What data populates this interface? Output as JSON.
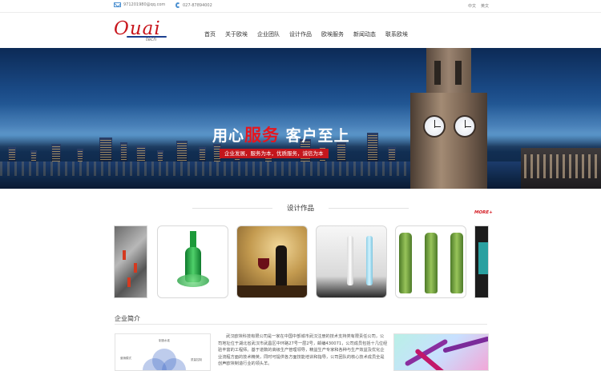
{
  "topbar": {
    "email": "971201980@qq.com",
    "phone": "027-87894002",
    "lang_zh": "中文",
    "lang_en": "英文"
  },
  "logo": {
    "text": "Ouai",
    "sub": "tech"
  },
  "nav": [
    "首页",
    "关于欧埃",
    "企业团队",
    "设计作品",
    "欧埃服务",
    "新闻动态",
    "联系欧埃"
  ],
  "banner": {
    "slogan_before": "用心",
    "slogan_highlight": "服务",
    "slogan_after": " 客户至上",
    "sub_slogan": "企业发展，服务为本，优质服务，诚信为本"
  },
  "works": {
    "title": "设计作品",
    "more": "MORE+"
  },
  "intro": {
    "title": "企业简介",
    "diagram_labels": [
      "制造水准",
      "营销模式",
      "质量控制"
    ],
    "text": "武汉欧埃科技有限公司是一家在中国中部城市武汉注册的技术支持类有限责任公司，公司地址位于湖北省武汉市武昌区中环路27号一层2号，邮编430071，公司成员包括十几位经验丰富的工程师。基于道数的高级生产管理领导，精益生产专家和各种与生产效益及优化企业流程方面的技术精英，同时可提供各方面技能培训和指导，公司团队的核心技术成员全是创声欧埃制造行业的领头羊。"
  }
}
